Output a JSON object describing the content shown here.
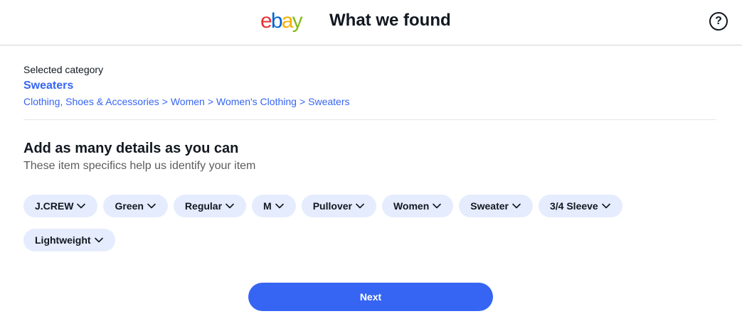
{
  "header": {
    "logo": {
      "e": "e",
      "b": "b",
      "a": "a",
      "y": "y"
    },
    "title": "What we found",
    "help_icon_glyph": "?",
    "help_icon": "question-circle-icon"
  },
  "category": {
    "caption": "Selected category",
    "name": "Sweaters",
    "breadcrumb": [
      "Clothing, Shoes & Accessories",
      "Women",
      "Women's Clothing",
      "Sweaters"
    ],
    "separator": ">"
  },
  "details": {
    "title": "Add as many details as you can",
    "subtitle": "These item specifics help us identify your item",
    "chips": [
      "J.CREW",
      "Green",
      "Regular",
      "M",
      "Pullover",
      "Women",
      "Sweater",
      "3/4 Sleeve",
      "Lightweight"
    ]
  },
  "actions": {
    "next_label": "Next"
  },
  "colors": {
    "accent": "#3665f3",
    "chip_bg": "#e5ecfd",
    "logo_red": "#e53238",
    "logo_blue": "#0064d2",
    "logo_yellow": "#f5af02",
    "logo_green": "#86b817"
  }
}
